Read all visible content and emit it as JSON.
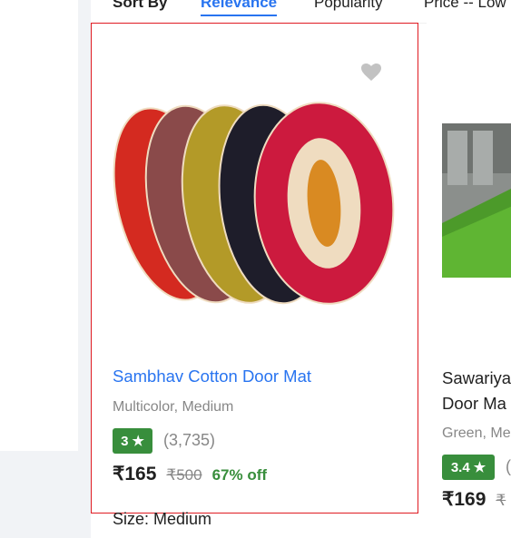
{
  "sort_bar": {
    "label": "Sort By",
    "tabs": [
      "Relevance",
      "Popularity",
      "Price -- Low"
    ]
  },
  "product": {
    "title": "Sambhav Cotton Door Mat",
    "variant": "Multicolor, Medium",
    "rating": "3",
    "rating_count": "(3,735)",
    "price": "₹165",
    "mrp": "₹500",
    "discount": "67% off",
    "size": "Size: Medium",
    "wishlist_icon": "heart-icon",
    "star_icon": "star-icon"
  },
  "product2": {
    "title_line1": "Sawariya",
    "title_line2": "Door Ma",
    "variant": "Green, Me",
    "rating": "3.4",
    "rating_paren": "(",
    "price": "₹169",
    "mrp": "₹"
  },
  "colors": {
    "accent": "#2874f0",
    "rating_green": "#388e3c",
    "selection_border": "#e01b22"
  }
}
